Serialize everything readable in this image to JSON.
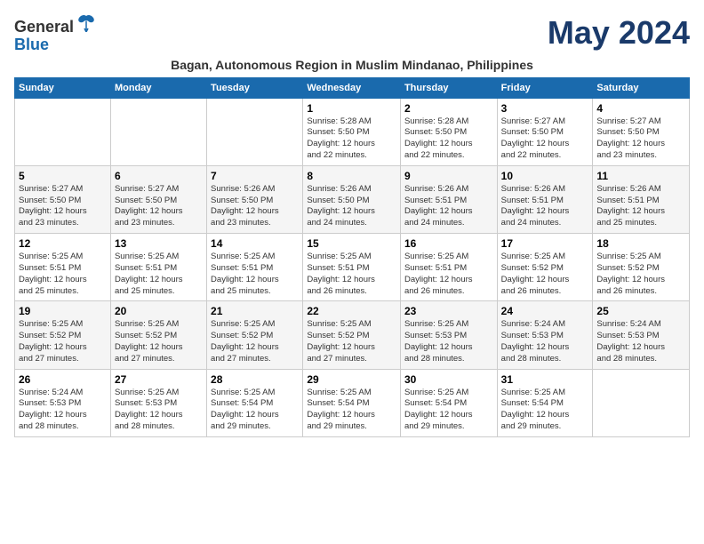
{
  "header": {
    "logo_line1": "General",
    "logo_line2": "Blue",
    "month_title": "May 2024",
    "location": "Bagan, Autonomous Region in Muslim Mindanao, Philippines"
  },
  "days_of_week": [
    "Sunday",
    "Monday",
    "Tuesday",
    "Wednesday",
    "Thursday",
    "Friday",
    "Saturday"
  ],
  "weeks": [
    [
      {
        "day": "",
        "info": ""
      },
      {
        "day": "",
        "info": ""
      },
      {
        "day": "",
        "info": ""
      },
      {
        "day": "1",
        "info": "Sunrise: 5:28 AM\nSunset: 5:50 PM\nDaylight: 12 hours\nand 22 minutes."
      },
      {
        "day": "2",
        "info": "Sunrise: 5:28 AM\nSunset: 5:50 PM\nDaylight: 12 hours\nand 22 minutes."
      },
      {
        "day": "3",
        "info": "Sunrise: 5:27 AM\nSunset: 5:50 PM\nDaylight: 12 hours\nand 22 minutes."
      },
      {
        "day": "4",
        "info": "Sunrise: 5:27 AM\nSunset: 5:50 PM\nDaylight: 12 hours\nand 23 minutes."
      }
    ],
    [
      {
        "day": "5",
        "info": "Sunrise: 5:27 AM\nSunset: 5:50 PM\nDaylight: 12 hours\nand 23 minutes."
      },
      {
        "day": "6",
        "info": "Sunrise: 5:27 AM\nSunset: 5:50 PM\nDaylight: 12 hours\nand 23 minutes."
      },
      {
        "day": "7",
        "info": "Sunrise: 5:26 AM\nSunset: 5:50 PM\nDaylight: 12 hours\nand 23 minutes."
      },
      {
        "day": "8",
        "info": "Sunrise: 5:26 AM\nSunset: 5:50 PM\nDaylight: 12 hours\nand 24 minutes."
      },
      {
        "day": "9",
        "info": "Sunrise: 5:26 AM\nSunset: 5:51 PM\nDaylight: 12 hours\nand 24 minutes."
      },
      {
        "day": "10",
        "info": "Sunrise: 5:26 AM\nSunset: 5:51 PM\nDaylight: 12 hours\nand 24 minutes."
      },
      {
        "day": "11",
        "info": "Sunrise: 5:26 AM\nSunset: 5:51 PM\nDaylight: 12 hours\nand 25 minutes."
      }
    ],
    [
      {
        "day": "12",
        "info": "Sunrise: 5:25 AM\nSunset: 5:51 PM\nDaylight: 12 hours\nand 25 minutes."
      },
      {
        "day": "13",
        "info": "Sunrise: 5:25 AM\nSunset: 5:51 PM\nDaylight: 12 hours\nand 25 minutes."
      },
      {
        "day": "14",
        "info": "Sunrise: 5:25 AM\nSunset: 5:51 PM\nDaylight: 12 hours\nand 25 minutes."
      },
      {
        "day": "15",
        "info": "Sunrise: 5:25 AM\nSunset: 5:51 PM\nDaylight: 12 hours\nand 26 minutes."
      },
      {
        "day": "16",
        "info": "Sunrise: 5:25 AM\nSunset: 5:51 PM\nDaylight: 12 hours\nand 26 minutes."
      },
      {
        "day": "17",
        "info": "Sunrise: 5:25 AM\nSunset: 5:52 PM\nDaylight: 12 hours\nand 26 minutes."
      },
      {
        "day": "18",
        "info": "Sunrise: 5:25 AM\nSunset: 5:52 PM\nDaylight: 12 hours\nand 26 minutes."
      }
    ],
    [
      {
        "day": "19",
        "info": "Sunrise: 5:25 AM\nSunset: 5:52 PM\nDaylight: 12 hours\nand 27 minutes."
      },
      {
        "day": "20",
        "info": "Sunrise: 5:25 AM\nSunset: 5:52 PM\nDaylight: 12 hours\nand 27 minutes."
      },
      {
        "day": "21",
        "info": "Sunrise: 5:25 AM\nSunset: 5:52 PM\nDaylight: 12 hours\nand 27 minutes."
      },
      {
        "day": "22",
        "info": "Sunrise: 5:25 AM\nSunset: 5:52 PM\nDaylight: 12 hours\nand 27 minutes."
      },
      {
        "day": "23",
        "info": "Sunrise: 5:25 AM\nSunset: 5:53 PM\nDaylight: 12 hours\nand 28 minutes."
      },
      {
        "day": "24",
        "info": "Sunrise: 5:24 AM\nSunset: 5:53 PM\nDaylight: 12 hours\nand 28 minutes."
      },
      {
        "day": "25",
        "info": "Sunrise: 5:24 AM\nSunset: 5:53 PM\nDaylight: 12 hours\nand 28 minutes."
      }
    ],
    [
      {
        "day": "26",
        "info": "Sunrise: 5:24 AM\nSunset: 5:53 PM\nDaylight: 12 hours\nand 28 minutes."
      },
      {
        "day": "27",
        "info": "Sunrise: 5:25 AM\nSunset: 5:53 PM\nDaylight: 12 hours\nand 28 minutes."
      },
      {
        "day": "28",
        "info": "Sunrise: 5:25 AM\nSunset: 5:54 PM\nDaylight: 12 hours\nand 29 minutes."
      },
      {
        "day": "29",
        "info": "Sunrise: 5:25 AM\nSunset: 5:54 PM\nDaylight: 12 hours\nand 29 minutes."
      },
      {
        "day": "30",
        "info": "Sunrise: 5:25 AM\nSunset: 5:54 PM\nDaylight: 12 hours\nand 29 minutes."
      },
      {
        "day": "31",
        "info": "Sunrise: 5:25 AM\nSunset: 5:54 PM\nDaylight: 12 hours\nand 29 minutes."
      },
      {
        "day": "",
        "info": ""
      }
    ]
  ]
}
